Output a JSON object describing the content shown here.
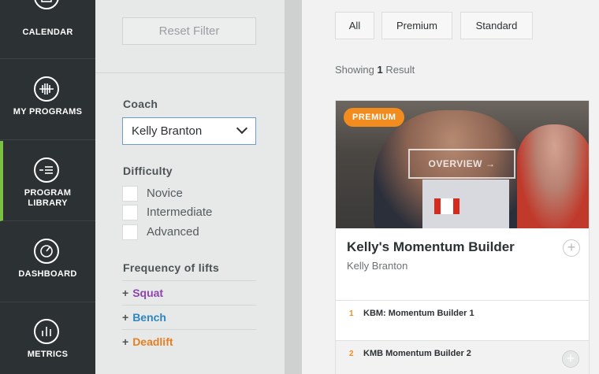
{
  "nav": {
    "items": [
      {
        "label": "CALENDAR",
        "icon": "calendar-icon"
      },
      {
        "label": "MY PROGRAMS",
        "icon": "program-icon"
      },
      {
        "label": "PROGRAM LIBRARY",
        "icon": "library-icon"
      },
      {
        "label": "DASHBOARD",
        "icon": "gauge-icon"
      },
      {
        "label": "METRICS",
        "icon": "bar-chart-icon"
      }
    ]
  },
  "filter": {
    "reset_label": "Reset Filter",
    "coach_title": "Coach",
    "coach_value": "Kelly Branton",
    "difficulty_title": "Difficulty",
    "difficulty_options": [
      "Novice",
      "Intermediate",
      "Advanced"
    ],
    "frequency_title": "Frequency of lifts",
    "lifts": [
      {
        "label": "Squat",
        "color": "#8e44ad"
      },
      {
        "label": "Bench",
        "color": "#2e86c1"
      },
      {
        "label": "Deadlift",
        "color": "#e67e22"
      }
    ]
  },
  "main": {
    "tabs": [
      "All",
      "Premium",
      "Standard"
    ],
    "showing_prefix": "Showing",
    "showing_count": "1",
    "showing_suffix": "Result",
    "card": {
      "badge": "PREMIUM",
      "overview_label": "OVERVIEW",
      "title": "Kelly's Momentum Builder",
      "coach": "Kelly Branton",
      "weeks": [
        {
          "num": "1",
          "name": "KBM: Momentum Builder 1"
        },
        {
          "num": "2",
          "name": "KMB Momentum Builder 2"
        }
      ]
    }
  }
}
